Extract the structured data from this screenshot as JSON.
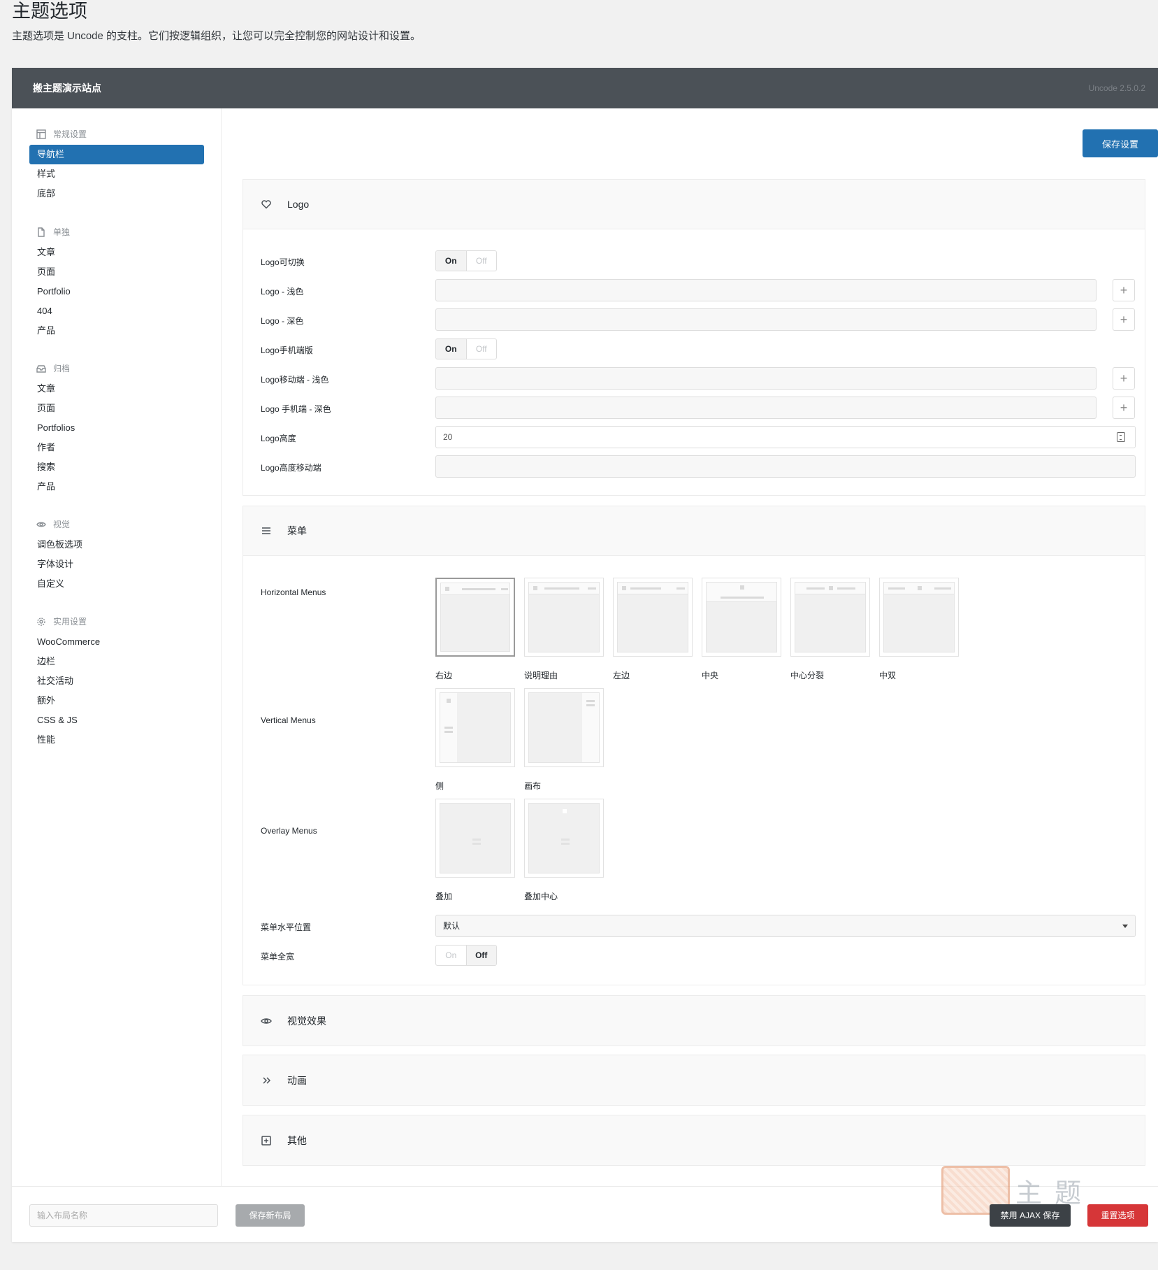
{
  "page": {
    "title": "主题选项",
    "description": "主题选项是 Uncode 的支柱。它们按逻辑组织，让您可以完全控制您的网站设计和设置。"
  },
  "header": {
    "site_name": "搬主题演示站点",
    "version": "Uncode 2.5.0.2"
  },
  "sidebar": {
    "groups": [
      {
        "title": "常规设置",
        "icon": "layout-icon",
        "items": [
          "导航栏",
          "样式",
          "底部"
        ]
      },
      {
        "title": "单独",
        "icon": "file-icon",
        "items": [
          "文章",
          "页面",
          "Portfolio",
          "404",
          "产品"
        ]
      },
      {
        "title": "归档",
        "icon": "inbox-icon",
        "items": [
          "文章",
          "页面",
          "Portfolios",
          "作者",
          "搜索",
          "产品"
        ]
      },
      {
        "title": "视觉",
        "icon": "eye-icon",
        "items": [
          "调色板选项",
          "字体设计",
          "自定义"
        ]
      },
      {
        "title": "实用设置",
        "icon": "gear-icon",
        "items": [
          "WooCommerce",
          "边栏",
          "社交活动",
          "额外",
          "CSS & JS",
          "性能"
        ]
      }
    ],
    "active_item": "导航栏"
  },
  "content": {
    "save_label": "保存设置",
    "logo_section": {
      "title": "Logo",
      "rows": [
        {
          "label": "Logo可切换",
          "type": "toggle",
          "on": "On",
          "off": "Off",
          "value": "On"
        },
        {
          "label": "Logo - 浅色",
          "type": "upload",
          "value": ""
        },
        {
          "label": "Logo - 深色",
          "type": "upload",
          "value": ""
        },
        {
          "label": "Logo手机端版",
          "type": "toggle",
          "on": "On",
          "off": "Off",
          "value": "On"
        },
        {
          "label": "Logo移动端 - 浅色",
          "type": "upload",
          "value": ""
        },
        {
          "label": "Logo 手机端 - 深色",
          "type": "upload",
          "value": ""
        },
        {
          "label": "Logo高度",
          "type": "number",
          "value": "20"
        },
        {
          "label": "Logo高度移动端",
          "type": "text",
          "value": ""
        }
      ]
    },
    "menu_section": {
      "title": "菜单",
      "horizontal_label": "Horizontal Menus",
      "horizontal_options": [
        "右边",
        "说明理由",
        "左边",
        "中央",
        "中心分裂",
        "中双"
      ],
      "vertical_label": "Vertical Menus",
      "vertical_options": [
        "侧",
        "画布"
      ],
      "overlay_label": "Overlay Menus",
      "overlay_options": [
        "叠加",
        "叠加中心"
      ],
      "position_label": "菜单水平位置",
      "position_value": "默认",
      "fullwidth_label": "菜单全宽",
      "fullwidth_on": "On",
      "fullwidth_off": "Off"
    },
    "collapsed_sections": [
      {
        "title": "视觉效果",
        "icon": "eye-icon"
      },
      {
        "title": "动画",
        "icon": "chevrons-right-icon"
      },
      {
        "title": "其他",
        "icon": "plus-square-icon"
      }
    ]
  },
  "footer": {
    "layout_placeholder": "输入布局名称",
    "save_layout_label": "保存新布局",
    "ajax_label": "禁用 AJAX 保存",
    "reset_label": "重置选项",
    "watermark_text": "主题"
  },
  "colors": {
    "primary": "#2271b1",
    "header_bg": "#4b5157",
    "danger": "#d63638",
    "dark": "#3c4146"
  }
}
